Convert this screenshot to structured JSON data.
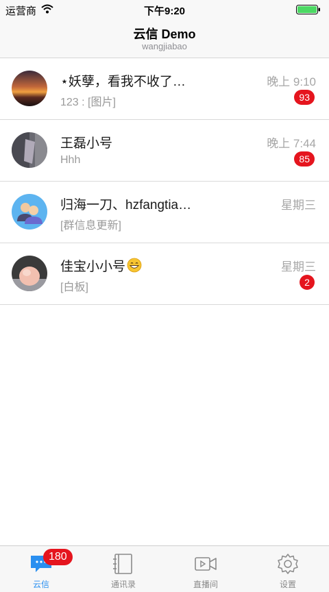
{
  "status": {
    "carrier": "运营商",
    "time": "下午9:20"
  },
  "nav": {
    "title": "云信 Demo",
    "subtitle": "wangjiabao"
  },
  "sessions": [
    {
      "name": "⋆妖孽，看我不收了…",
      "preview": "123 : [图片]",
      "time": "晚上 9:10",
      "unread": "93"
    },
    {
      "name": "王磊小号",
      "preview": "Hhh",
      "time": "晚上 7:44",
      "unread": "85"
    },
    {
      "name": "归海一刀、hzfangtia…",
      "preview": "[群信息更新]",
      "time": "星期三",
      "unread": ""
    },
    {
      "name": "佳宝小小号",
      "preview": "[白板]",
      "time": "星期三",
      "unread": "2"
    }
  ],
  "tabs": [
    {
      "label": "云信",
      "badge": "180",
      "icon": "chat-bubble-icon"
    },
    {
      "label": "通讯录",
      "icon": "contacts-book-icon"
    },
    {
      "label": "直播间",
      "icon": "video-camera-icon"
    },
    {
      "label": "设置",
      "icon": "gear-icon"
    }
  ],
  "colors": {
    "accent": "#2a8ff0",
    "badge": "#e5151e",
    "muted": "#a6a6a6"
  }
}
